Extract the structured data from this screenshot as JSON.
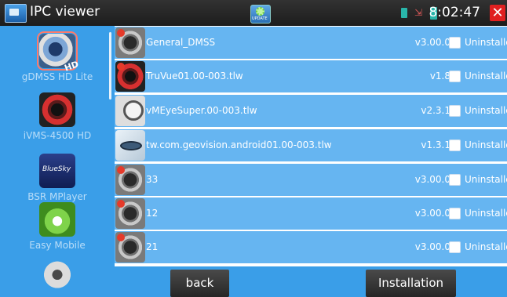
{
  "title_bar": {
    "title": "IPC viewer",
    "update_label": "UPDATE",
    "time": "8:02:47",
    "close_label": "✕"
  },
  "sidebar": {
    "items": [
      {
        "label": "gDMSS HD Lite",
        "icon": "gdmss-hd-icon",
        "selected": true
      },
      {
        "label": "iVMS-4500 HD",
        "icon": "ivms-icon",
        "selected": false
      },
      {
        "label": "BSR MPlayer",
        "icon": "bluesky-icon",
        "selected": false
      },
      {
        "label": "Easy Mobile",
        "icon": "easy-mobile-icon",
        "selected": false
      },
      {
        "label": "",
        "icon": "camera-robot-icon",
        "selected": false
      }
    ]
  },
  "plugins": [
    {
      "name": "General_DMSS",
      "version": "v3.00.0",
      "status": "Uninstalled",
      "icon": "dmss-lens-icon"
    },
    {
      "name": "TruVue01.00-003.tlw",
      "version": "v1.8",
      "status": "Uninstalled",
      "icon": "truvue-hd-lens-icon"
    },
    {
      "name": "vMEyeSuper.00-003.tlw",
      "version": "v2.3.1",
      "status": "Uninstalled",
      "icon": "vmeye-webcam-icon"
    },
    {
      "name": "tw.com.geovision.android01.00-003.tlw",
      "version": "v1.3.1",
      "status": "Uninstalled",
      "icon": "geovision-eye-icon"
    },
    {
      "name": "33",
      "version": "v3.00.0",
      "status": "Uninstalled",
      "icon": "dmss-lens-icon"
    },
    {
      "name": "12",
      "version": "v3.00.0",
      "status": "Uninstalled",
      "icon": "dmss-lens-icon"
    },
    {
      "name": "21",
      "version": "v3.00.0",
      "status": "Uninstalled",
      "icon": "dmss-lens-icon"
    }
  ],
  "footer": {
    "back_label": "back",
    "install_label": "Installation"
  },
  "colors": {
    "list_bg": "#66b5f1",
    "sidebar_bg": "#3a9ee8",
    "title_bg": "#1c1c1c",
    "close": "#e02020"
  }
}
